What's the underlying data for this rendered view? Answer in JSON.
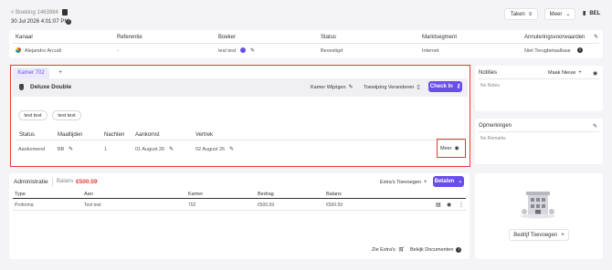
{
  "header": {
    "back_label": "< Boeking 1463984",
    "datetime": "30 Jul 2026 4:01:07 PM",
    "tasks_label": "Taken",
    "more_label": "Meer",
    "call_label": "BEL"
  },
  "booking_table": {
    "columns": [
      "Kanaal",
      "Referentie",
      "Boeker",
      "Status",
      "Marktsegment",
      "Annuleringsvoorwaarden"
    ],
    "row": {
      "kanaal": "Alejandro Arcudi",
      "referentie": "-",
      "boeker": "test test",
      "status": "Bevestigd",
      "marktsegment": "Internet",
      "annulering": "Niet Terugbetaalbaar"
    }
  },
  "room": {
    "tab_label": "Kamer 702",
    "add_tab": "+",
    "room_type": "Deluxe Double",
    "change_room_label": "Kamer Wijzigen",
    "change_assignment_label": "Toewijzing Veranderen",
    "checkin_label": "Check In",
    "guests": [
      "test test",
      "test test"
    ],
    "columns": [
      "Status",
      "Maaltijden",
      "Nachten",
      "Aankomst",
      "Vertrek"
    ],
    "row": {
      "status": "Aankomend",
      "meals": "BB",
      "nights": "1",
      "arrival": "01 August 26",
      "departure": "02 August 26"
    },
    "more_label": "Meer"
  },
  "admin": {
    "title": "Administratie",
    "balance_label": "Balans",
    "balance_value": "€500.59",
    "add_extras_label": "Extra's Toevoegen",
    "pay_label": "Betalen",
    "columns": [
      "Type",
      "Aan",
      "Kamer",
      "Bedrag",
      "Balans"
    ],
    "row": {
      "type": "Proforma",
      "aan": "Test test",
      "kamer": "702",
      "bedrag": "€500.59",
      "balans": "€500.59"
    },
    "see_extras_label": "Zie Extra's",
    "view_docs_label": "Bekijk Documenten"
  },
  "notes": {
    "title": "Notities",
    "create_label": "Maak Nieuw",
    "empty": "No Notes"
  },
  "remarks": {
    "title": "Opmerkingen",
    "empty": "No Remarks"
  },
  "company": {
    "add_label": "Bedrijf Toevoegen"
  },
  "colors": {
    "accent": "#6a4ee8",
    "highlight": "#e53935",
    "balance": "#e53935"
  }
}
